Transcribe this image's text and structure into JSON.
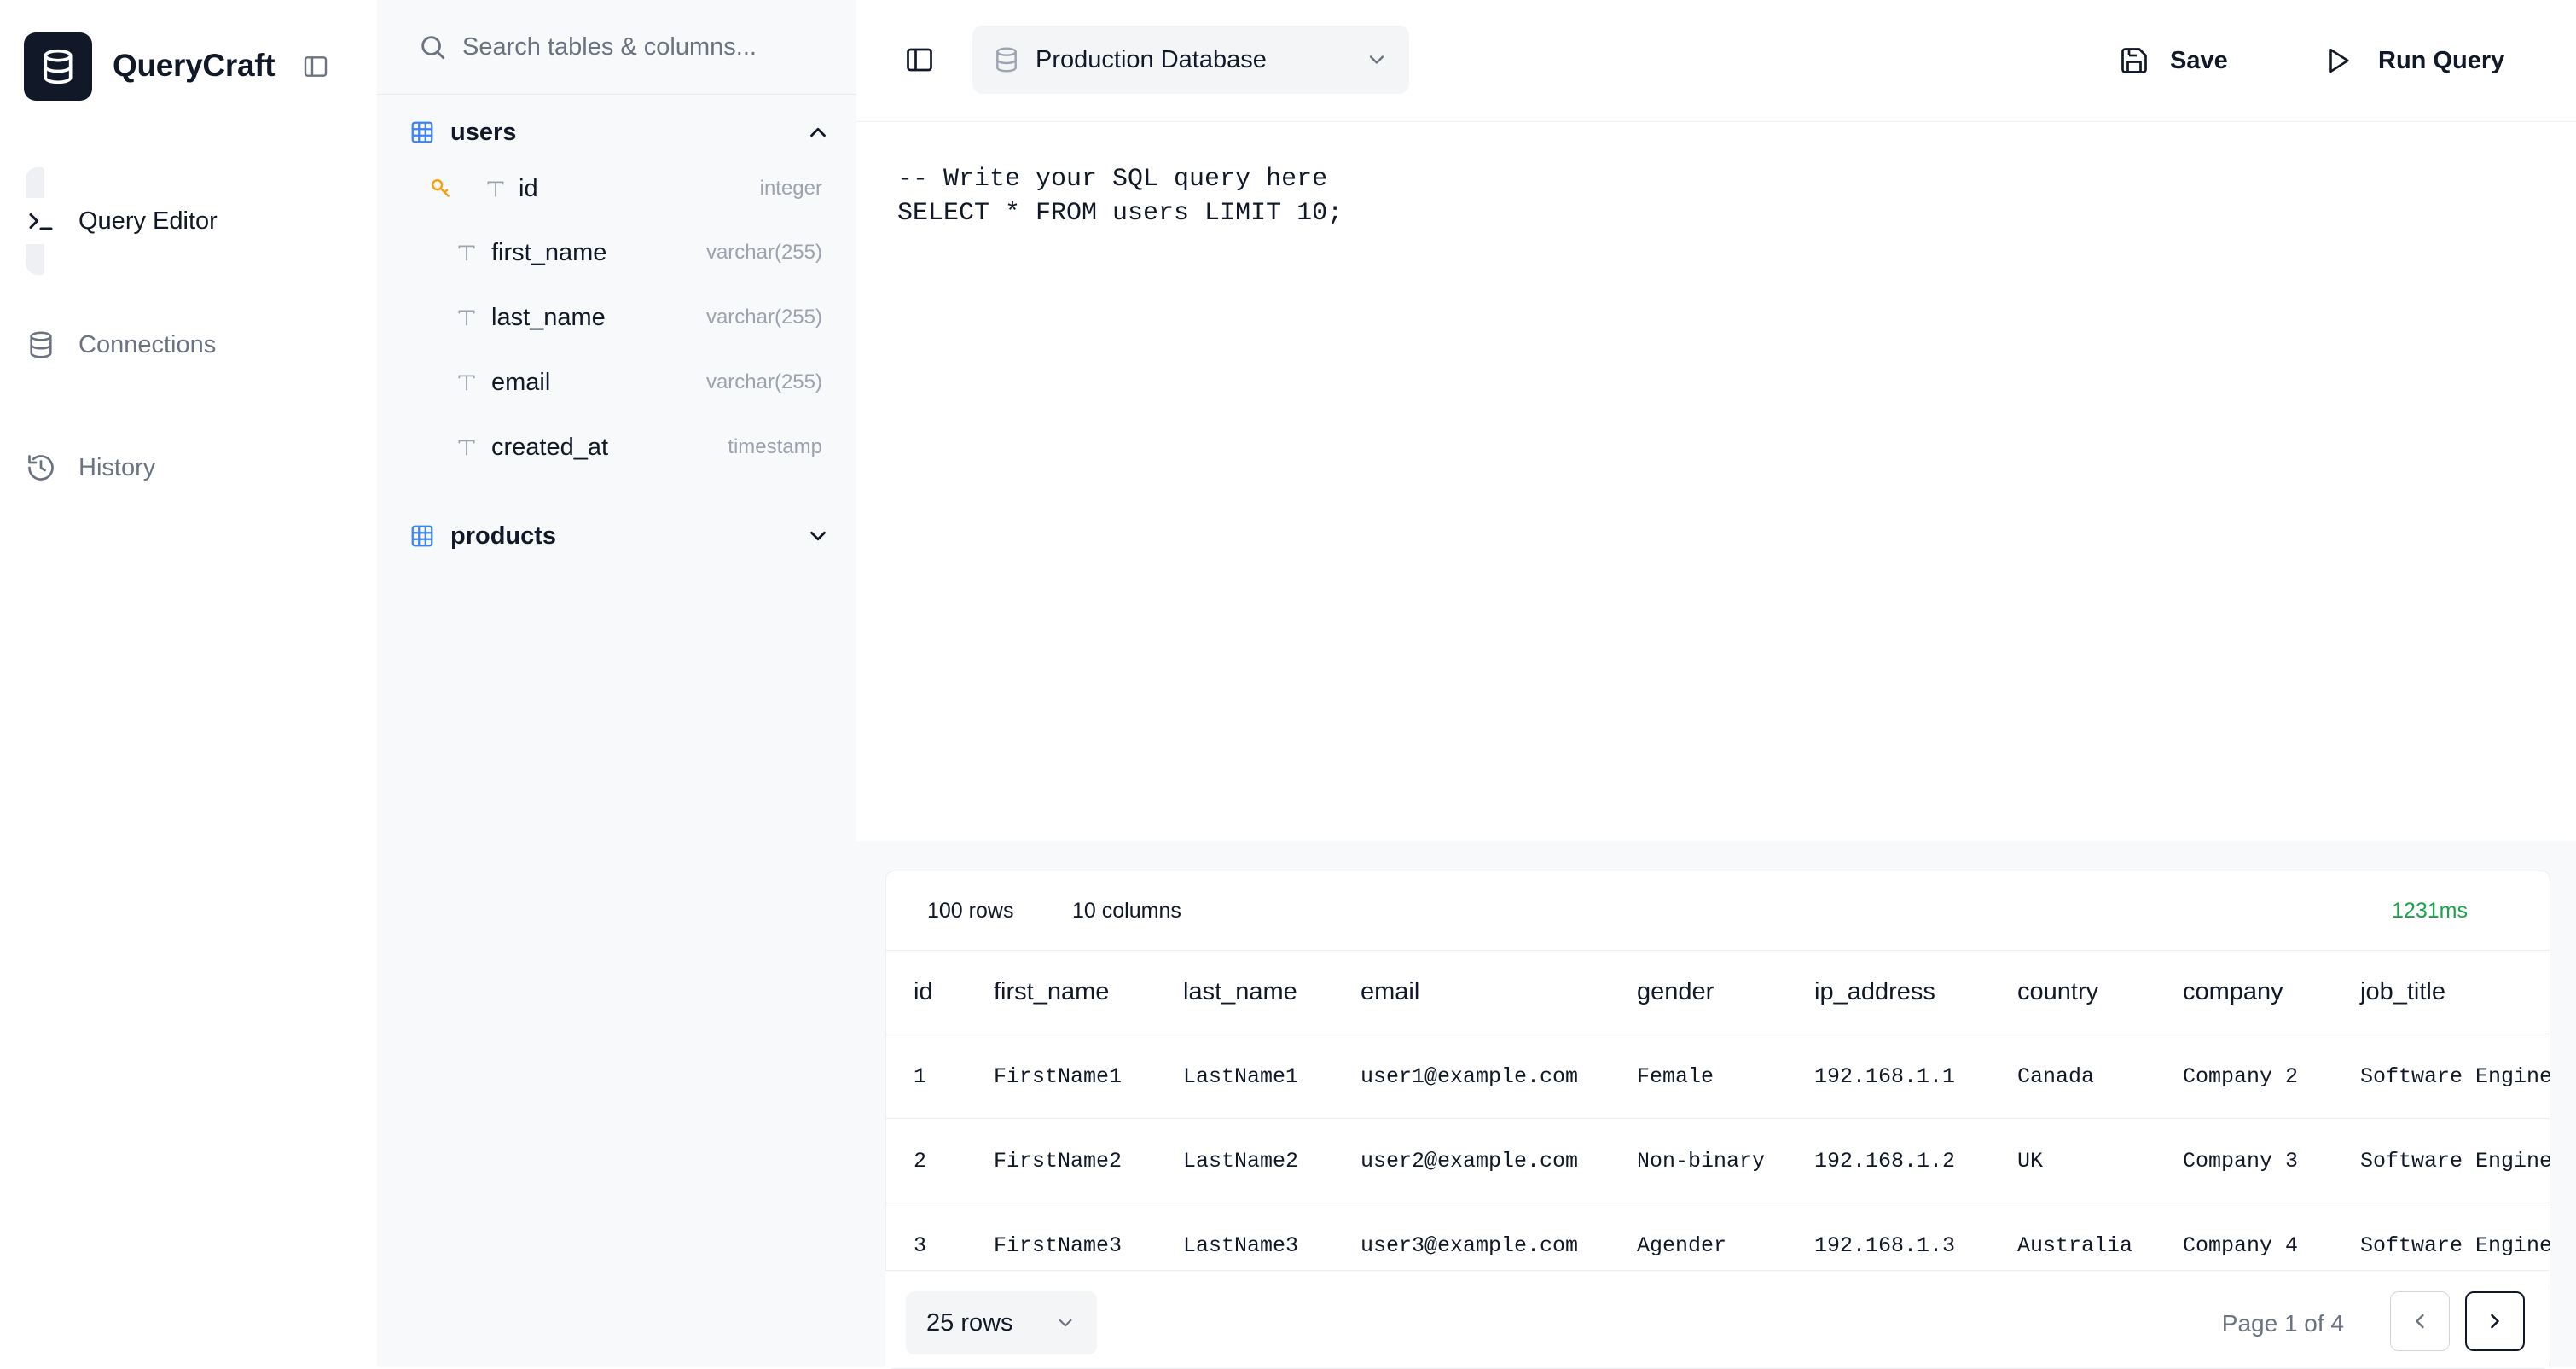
{
  "app": {
    "name": "QueryCraft"
  },
  "nav": {
    "items": [
      {
        "label": "Query Editor",
        "icon": "terminal-icon",
        "active": true
      },
      {
        "label": "Connections",
        "icon": "database-icon",
        "active": false
      },
      {
        "label": "History",
        "icon": "history-icon",
        "active": false
      }
    ]
  },
  "schema": {
    "search_placeholder": "Search tables & columns...",
    "tables": [
      {
        "name": "users",
        "expanded": true,
        "columns": [
          {
            "name": "id",
            "type": "integer",
            "primary_key": true
          },
          {
            "name": "first_name",
            "type": "varchar(255)"
          },
          {
            "name": "last_name",
            "type": "varchar(255)"
          },
          {
            "name": "email",
            "type": "varchar(255)"
          },
          {
            "name": "created_at",
            "type": "timestamp"
          }
        ]
      },
      {
        "name": "products",
        "expanded": false,
        "columns": []
      }
    ]
  },
  "toolbar": {
    "database": "Production Database",
    "save_label": "Save",
    "run_label": "Run Query"
  },
  "editor": {
    "lines": [
      "-- Write your SQL query here",
      "SELECT * FROM users LIMIT 10;"
    ]
  },
  "results": {
    "row_count": "100 rows",
    "column_count": "10 columns",
    "duration": "1231ms",
    "headers": [
      "id",
      "first_name",
      "last_name",
      "email",
      "gender",
      "ip_address",
      "country",
      "company",
      "job_title"
    ],
    "rows": [
      [
        "1",
        "FirstName1",
        "LastName1",
        "user1@example.com",
        "Female",
        "192.168.1.1",
        "Canada",
        "Company 2",
        "Software Engine"
      ],
      [
        "2",
        "FirstName2",
        "LastName2",
        "user2@example.com",
        "Non-binary",
        "192.168.1.2",
        "UK",
        "Company 3",
        "Software Engine"
      ],
      [
        "3",
        "FirstName3",
        "LastName3",
        "user3@example.com",
        "Agender",
        "192.168.1.3",
        "Australia",
        "Company 4",
        "Software Engine"
      ]
    ]
  },
  "pagination": {
    "rows_per_page": "25 rows",
    "page_label": "Page 1 of 4"
  },
  "colors": {
    "accent_blue": "#3b82f6",
    "key_yellow": "#f59e0b",
    "success_green": "#16a34a",
    "dark": "#111827"
  }
}
